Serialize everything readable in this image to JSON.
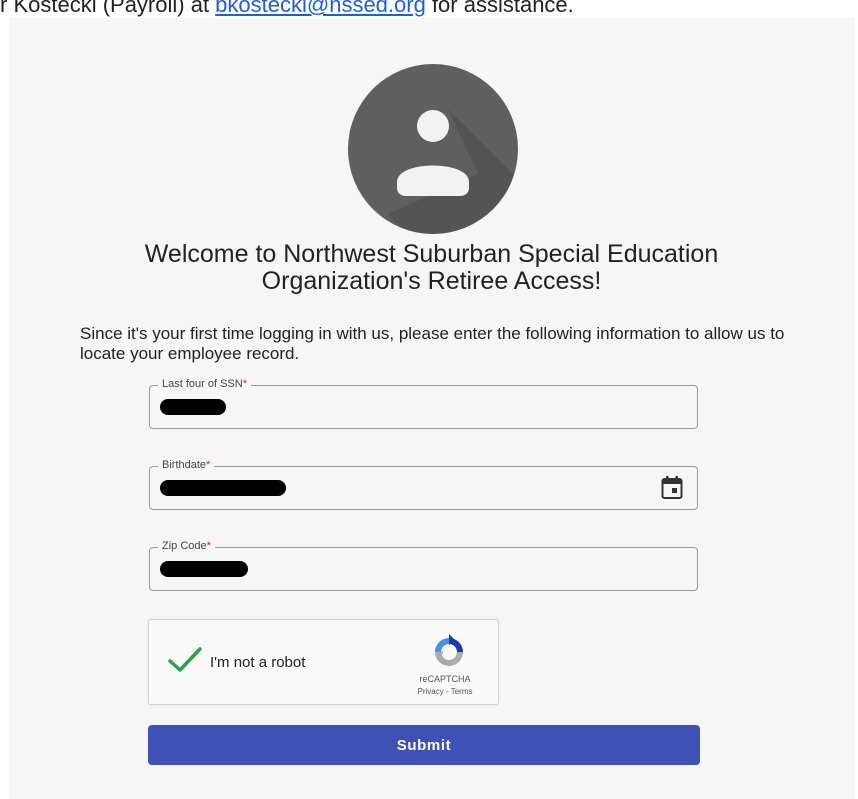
{
  "top_strip": {
    "prefix": "r Kostecki (Payroll) at ",
    "email_link": "bkostecki@nssed.org",
    "suffix": " for assistance."
  },
  "avatar": {
    "icon": "account-circle-icon"
  },
  "welcome": {
    "line1": "Welcome to Northwest Suburban Special Education",
    "line2": "Organization's Retiree Access!"
  },
  "intro": "Since it's your first time logging in with us, please enter the following information to allow us to locate your employee record.",
  "fields": {
    "ssn": {
      "label": "Last four of SSN",
      "required_mark": "*"
    },
    "birthdate": {
      "label": "Birthdate",
      "required_mark": "*",
      "icon": "calendar-icon"
    },
    "zip": {
      "label": "Zip Code",
      "required_mark": "*"
    }
  },
  "recaptcha": {
    "label": "I'm not a robot",
    "brand": "reCAPTCHA",
    "privacy": "Privacy",
    "separator": " - ",
    "terms": "Terms",
    "checked": true
  },
  "submit_label": "Submit",
  "colors": {
    "primary": "#3f51b5",
    "check_green": "#2e9e4a",
    "required": "#c62828",
    "avatar_gray": "#5f5f5f",
    "card_bg": "#f6f6f6"
  }
}
